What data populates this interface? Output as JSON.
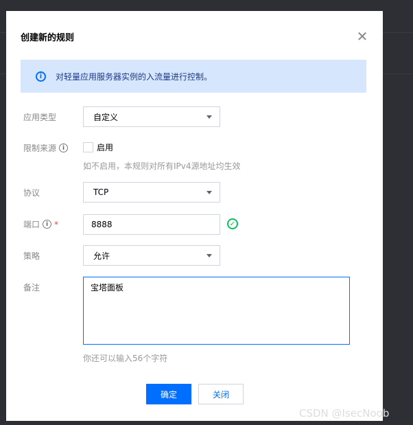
{
  "dialog": {
    "title": "创建新的规则",
    "close_icon": "close-icon"
  },
  "alert": {
    "icon": "info-icon",
    "text": "对轻量应用服务器实例的入流量进行控制。"
  },
  "form": {
    "app_type": {
      "label": "应用类型",
      "value": "自定义"
    },
    "source": {
      "label": "限制来源",
      "checkbox_label": "启用",
      "checked": false,
      "hint": "如不启用，本规则对所有IPv4源地址均生效"
    },
    "protocol": {
      "label": "协议",
      "value": "TCP"
    },
    "port": {
      "label": "端口",
      "required": "*",
      "value": "8888",
      "valid": true
    },
    "policy": {
      "label": "策略",
      "value": "允许"
    },
    "note": {
      "label": "备注",
      "value": "宝塔面板",
      "hint": "你还可以输入56个字符"
    }
  },
  "buttons": {
    "confirm": "确定",
    "close": "关闭"
  },
  "watermark": "CSDN @IsecNoob",
  "colors": {
    "primary": "#006eff",
    "success": "#0abf5b",
    "alert_bg": "#d5e6fd"
  }
}
